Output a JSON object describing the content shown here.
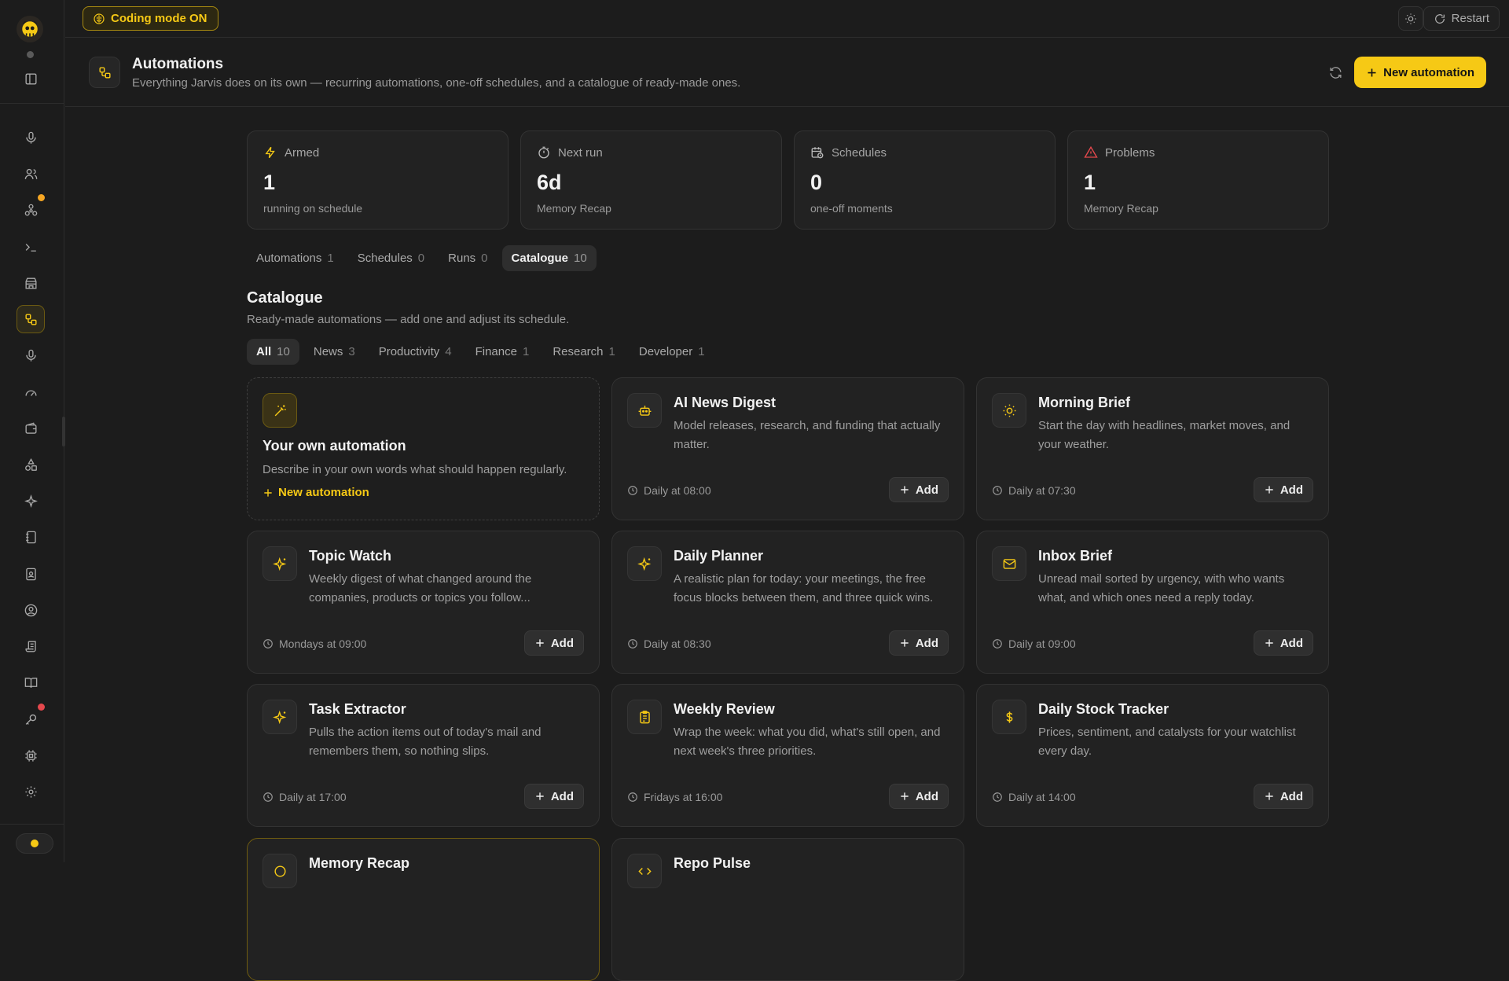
{
  "topbar": {
    "coding_mode": "Coding mode ON",
    "restart": "Restart"
  },
  "header": {
    "title": "Automations",
    "subtitle": "Everything Jarvis does on its own — recurring automations, one-off schedules, and a catalogue of ready-made ones.",
    "new_button": "New automation"
  },
  "stats": [
    {
      "label": "Armed",
      "value": "1",
      "sub": "running on schedule",
      "icon": "lightning-icon"
    },
    {
      "label": "Next run",
      "value": "6d",
      "sub": "Memory Recap",
      "icon": "timer-icon"
    },
    {
      "label": "Schedules",
      "value": "0",
      "sub": "one-off moments",
      "icon": "calendar-clock-icon"
    },
    {
      "label": "Problems",
      "value": "1",
      "sub": "Memory Recap",
      "icon": "warning-icon"
    }
  ],
  "tabs": [
    {
      "label": "Automations",
      "count": "1"
    },
    {
      "label": "Schedules",
      "count": "0"
    },
    {
      "label": "Runs",
      "count": "0"
    },
    {
      "label": "Catalogue",
      "count": "10"
    }
  ],
  "catalogue": {
    "title": "Catalogue",
    "subtitle": "Ready-made automations — add one and adjust its schedule.",
    "filters": [
      {
        "label": "All",
        "count": "10"
      },
      {
        "label": "News",
        "count": "3"
      },
      {
        "label": "Productivity",
        "count": "4"
      },
      {
        "label": "Finance",
        "count": "1"
      },
      {
        "label": "Research",
        "count": "1"
      },
      {
        "label": "Developer",
        "count": "1"
      }
    ],
    "own": {
      "title": "Your own automation",
      "desc": "Describe in your own words what should happen regularly.",
      "link": "New automation"
    },
    "add_label": "Add",
    "cards": [
      {
        "title": "AI News Digest",
        "desc": "Model releases, research, and funding that actually matter.",
        "schedule": "Daily at 08:00",
        "icon": "robot-icon"
      },
      {
        "title": "Morning Brief",
        "desc": "Start the day with headlines, market moves, and your weather.",
        "schedule": "Daily at 07:30",
        "icon": "sun-icon"
      },
      {
        "title": "Topic Watch",
        "desc": "Weekly digest of what changed around the companies, products or topics you follow...",
        "schedule": "Mondays at 09:00",
        "icon": "sparkle-icon"
      },
      {
        "title": "Daily Planner",
        "desc": "A realistic plan for today: your meetings, the free focus blocks between them, and three quick wins.",
        "schedule": "Daily at 08:30",
        "icon": "sparkle-icon"
      },
      {
        "title": "Inbox Brief",
        "desc": "Unread mail sorted by urgency, with who wants what, and which ones need a reply today.",
        "schedule": "Daily at 09:00",
        "icon": "mail-icon"
      },
      {
        "title": "Task Extractor",
        "desc": "Pulls the action items out of today's mail and remembers them, so nothing slips.",
        "schedule": "Daily at 17:00",
        "icon": "sparkle-icon"
      },
      {
        "title": "Weekly Review",
        "desc": "Wrap the week: what you did, what's still open, and next week's three priorities.",
        "schedule": "Fridays at 16:00",
        "icon": "clipboard-icon"
      },
      {
        "title": "Daily Stock Tracker",
        "desc": "Prices, sentiment, and catalysts for your watchlist every day.",
        "schedule": "Daily at 14:00",
        "icon": "dollar-icon"
      },
      {
        "title": "Memory Recap",
        "desc": "",
        "schedule": "",
        "icon": "brain-icon"
      },
      {
        "title": "Repo Pulse",
        "desc": "",
        "schedule": "",
        "icon": "code-icon"
      }
    ]
  },
  "colors": {
    "accent": "#f6c915",
    "background": "#1c1c1c",
    "card": "#222222",
    "problem": "#e5484d",
    "badge_orange": "#f5a623",
    "badge_red": "#e5484d"
  }
}
